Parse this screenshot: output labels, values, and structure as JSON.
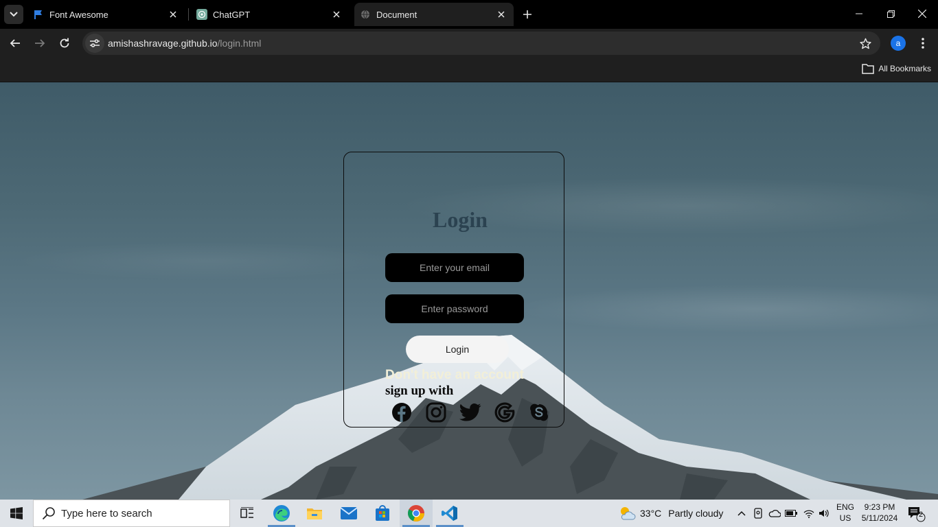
{
  "browser": {
    "tabs": [
      {
        "title": "Font Awesome",
        "active": false
      },
      {
        "title": "ChatGPT",
        "active": false
      },
      {
        "title": "Document",
        "active": true
      }
    ],
    "url_host": "amishashravage.github.io",
    "url_path": "/login.html",
    "profile_initial": "a",
    "bookmarks_label": "All Bookmarks"
  },
  "page": {
    "title": "Login",
    "email_placeholder": "Enter your email",
    "password_placeholder": "Enter password",
    "login_button": "Login",
    "signup_question": "Don't have an account",
    "signup_with": "sign up with",
    "social_icons": [
      "facebook-icon",
      "instagram-icon",
      "twitter-icon",
      "google-icon",
      "skype-icon"
    ]
  },
  "taskbar": {
    "search_placeholder": "Type here to search",
    "weather_temp": "33°C",
    "weather_desc": "Partly cloudy",
    "lang_line1": "ENG",
    "lang_line2": "US",
    "time": "9:23 PM",
    "date": "5/11/2024",
    "notification_count": "2",
    "apps": [
      "task-view",
      "edge",
      "file-explorer",
      "mail",
      "store",
      "chrome",
      "vscode"
    ]
  },
  "colors": {
    "accent": "#1a73e8",
    "page_title": "#2b4250",
    "signup_question": "#f2efd8"
  }
}
